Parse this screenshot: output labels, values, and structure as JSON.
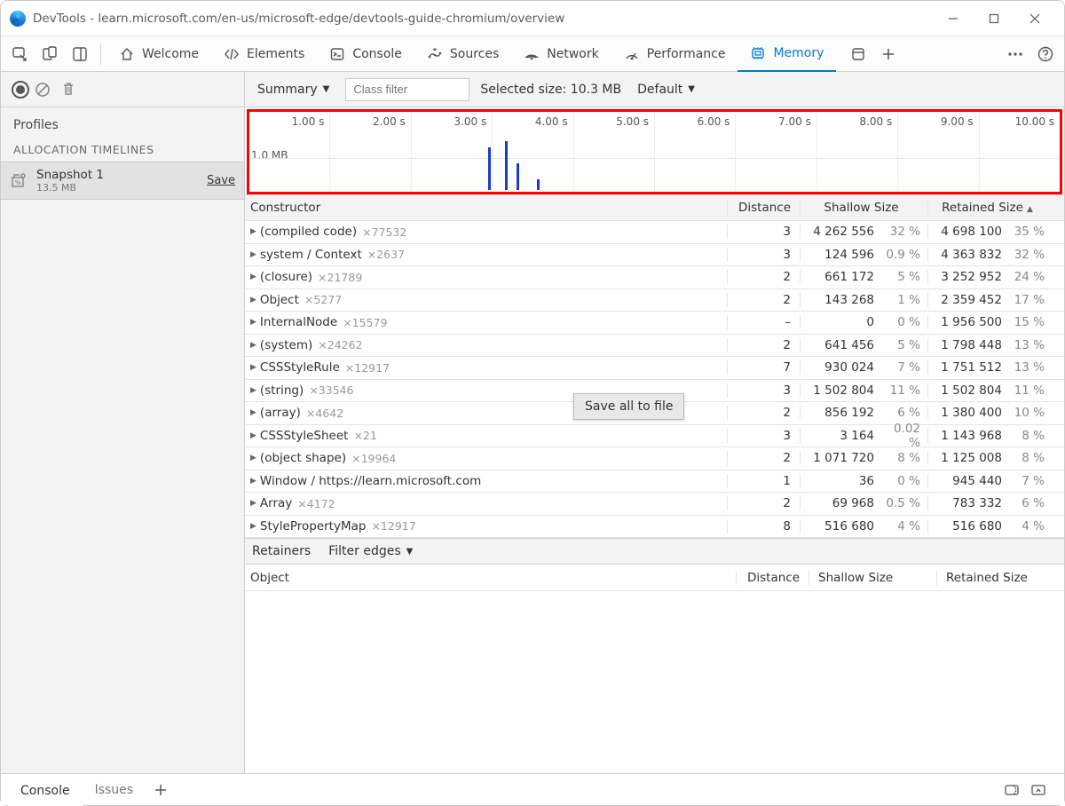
{
  "window": {
    "title": "DevTools - learn.microsoft.com/en-us/microsoft-edge/devtools-guide-chromium/overview"
  },
  "toolbar_tabs": [
    {
      "label": "Welcome"
    },
    {
      "label": "Elements"
    },
    {
      "label": "Console"
    },
    {
      "label": "Sources"
    },
    {
      "label": "Network"
    },
    {
      "label": "Performance"
    },
    {
      "label": "Memory"
    }
  ],
  "left": {
    "profiles_label": "Profiles",
    "timelines_label": "ALLOCATION TIMELINES",
    "snapshot": {
      "title": "Snapshot 1",
      "size": "13.5 MB",
      "save": "Save"
    }
  },
  "filterbar": {
    "summary": "Summary",
    "class_filter_placeholder": "Class filter",
    "selected_size": "Selected size: 10.3 MB",
    "default": "Default"
  },
  "timeline": {
    "ticks": [
      "1.00 s",
      "2.00 s",
      "3.00 s",
      "4.00 s",
      "5.00 s",
      "6.00 s",
      "7.00 s",
      "8.00 s",
      "9.00 s",
      "10.00 s"
    ],
    "ylabel": "1.0 MB"
  },
  "grid": {
    "headers": {
      "constructor": "Constructor",
      "distance": "Distance",
      "shallow": "Shallow Size",
      "retained": "Retained Size"
    },
    "rows": [
      {
        "name": "(compiled code)",
        "count": "×77532",
        "dist": "3",
        "shallow": "4 262 556",
        "sp": "32 %",
        "ret": "4 698 100",
        "rp": "35 %"
      },
      {
        "name": "system / Context",
        "count": "×2637",
        "dist": "3",
        "shallow": "124 596",
        "sp": "0.9 %",
        "ret": "4 363 832",
        "rp": "32 %"
      },
      {
        "name": "(closure)",
        "count": "×21789",
        "dist": "2",
        "shallow": "661 172",
        "sp": "5 %",
        "ret": "3 252 952",
        "rp": "24 %"
      },
      {
        "name": "Object",
        "count": "×5277",
        "dist": "2",
        "shallow": "143 268",
        "sp": "1 %",
        "ret": "2 359 452",
        "rp": "17 %"
      },
      {
        "name": "InternalNode",
        "count": "×15579",
        "dist": "–",
        "shallow": "0",
        "sp": "0 %",
        "ret": "1 956 500",
        "rp": "15 %"
      },
      {
        "name": "(system)",
        "count": "×24262",
        "dist": "2",
        "shallow": "641 456",
        "sp": "5 %",
        "ret": "1 798 448",
        "rp": "13 %"
      },
      {
        "name": "CSSStyleRule",
        "count": "×12917",
        "dist": "7",
        "shallow": "930 024",
        "sp": "7 %",
        "ret": "1 751 512",
        "rp": "13 %"
      },
      {
        "name": "(string)",
        "count": "×33546",
        "dist": "3",
        "shallow": "1 502 804",
        "sp": "11 %",
        "ret": "1 502 804",
        "rp": "11 %"
      },
      {
        "name": "(array)",
        "count": "×4642",
        "dist": "2",
        "shallow": "856 192",
        "sp": "6 %",
        "ret": "1 380 400",
        "rp": "10 %"
      },
      {
        "name": "CSSStyleSheet",
        "count": "×21",
        "dist": "3",
        "shallow": "3 164",
        "sp": "0.02 %",
        "ret": "1 143 968",
        "rp": "8 %"
      },
      {
        "name": "(object shape)",
        "count": "×19964",
        "dist": "2",
        "shallow": "1 071 720",
        "sp": "8 %",
        "ret": "1 125 008",
        "rp": "8 %"
      },
      {
        "name": "Window / https://learn.microsoft.com",
        "count": "",
        "dist": "1",
        "shallow": "36",
        "sp": "0 %",
        "ret": "945 440",
        "rp": "7 %"
      },
      {
        "name": "Array",
        "count": "×4172",
        "dist": "2",
        "shallow": "69 968",
        "sp": "0.5 %",
        "ret": "783 332",
        "rp": "6 %"
      },
      {
        "name": "StylePropertyMap",
        "count": "×12917",
        "dist": "8",
        "shallow": "516 680",
        "sp": "4 %",
        "ret": "516 680",
        "rp": "4 %"
      }
    ]
  },
  "context_menu": {
    "label": "Save all to file"
  },
  "retainers": {
    "label": "Retainers",
    "filter": "Filter edges",
    "headers": {
      "object": "Object",
      "distance": "Distance",
      "shallow": "Shallow Size",
      "retained": "Retained Size"
    }
  },
  "footer": {
    "console": "Console",
    "issues": "Issues"
  }
}
